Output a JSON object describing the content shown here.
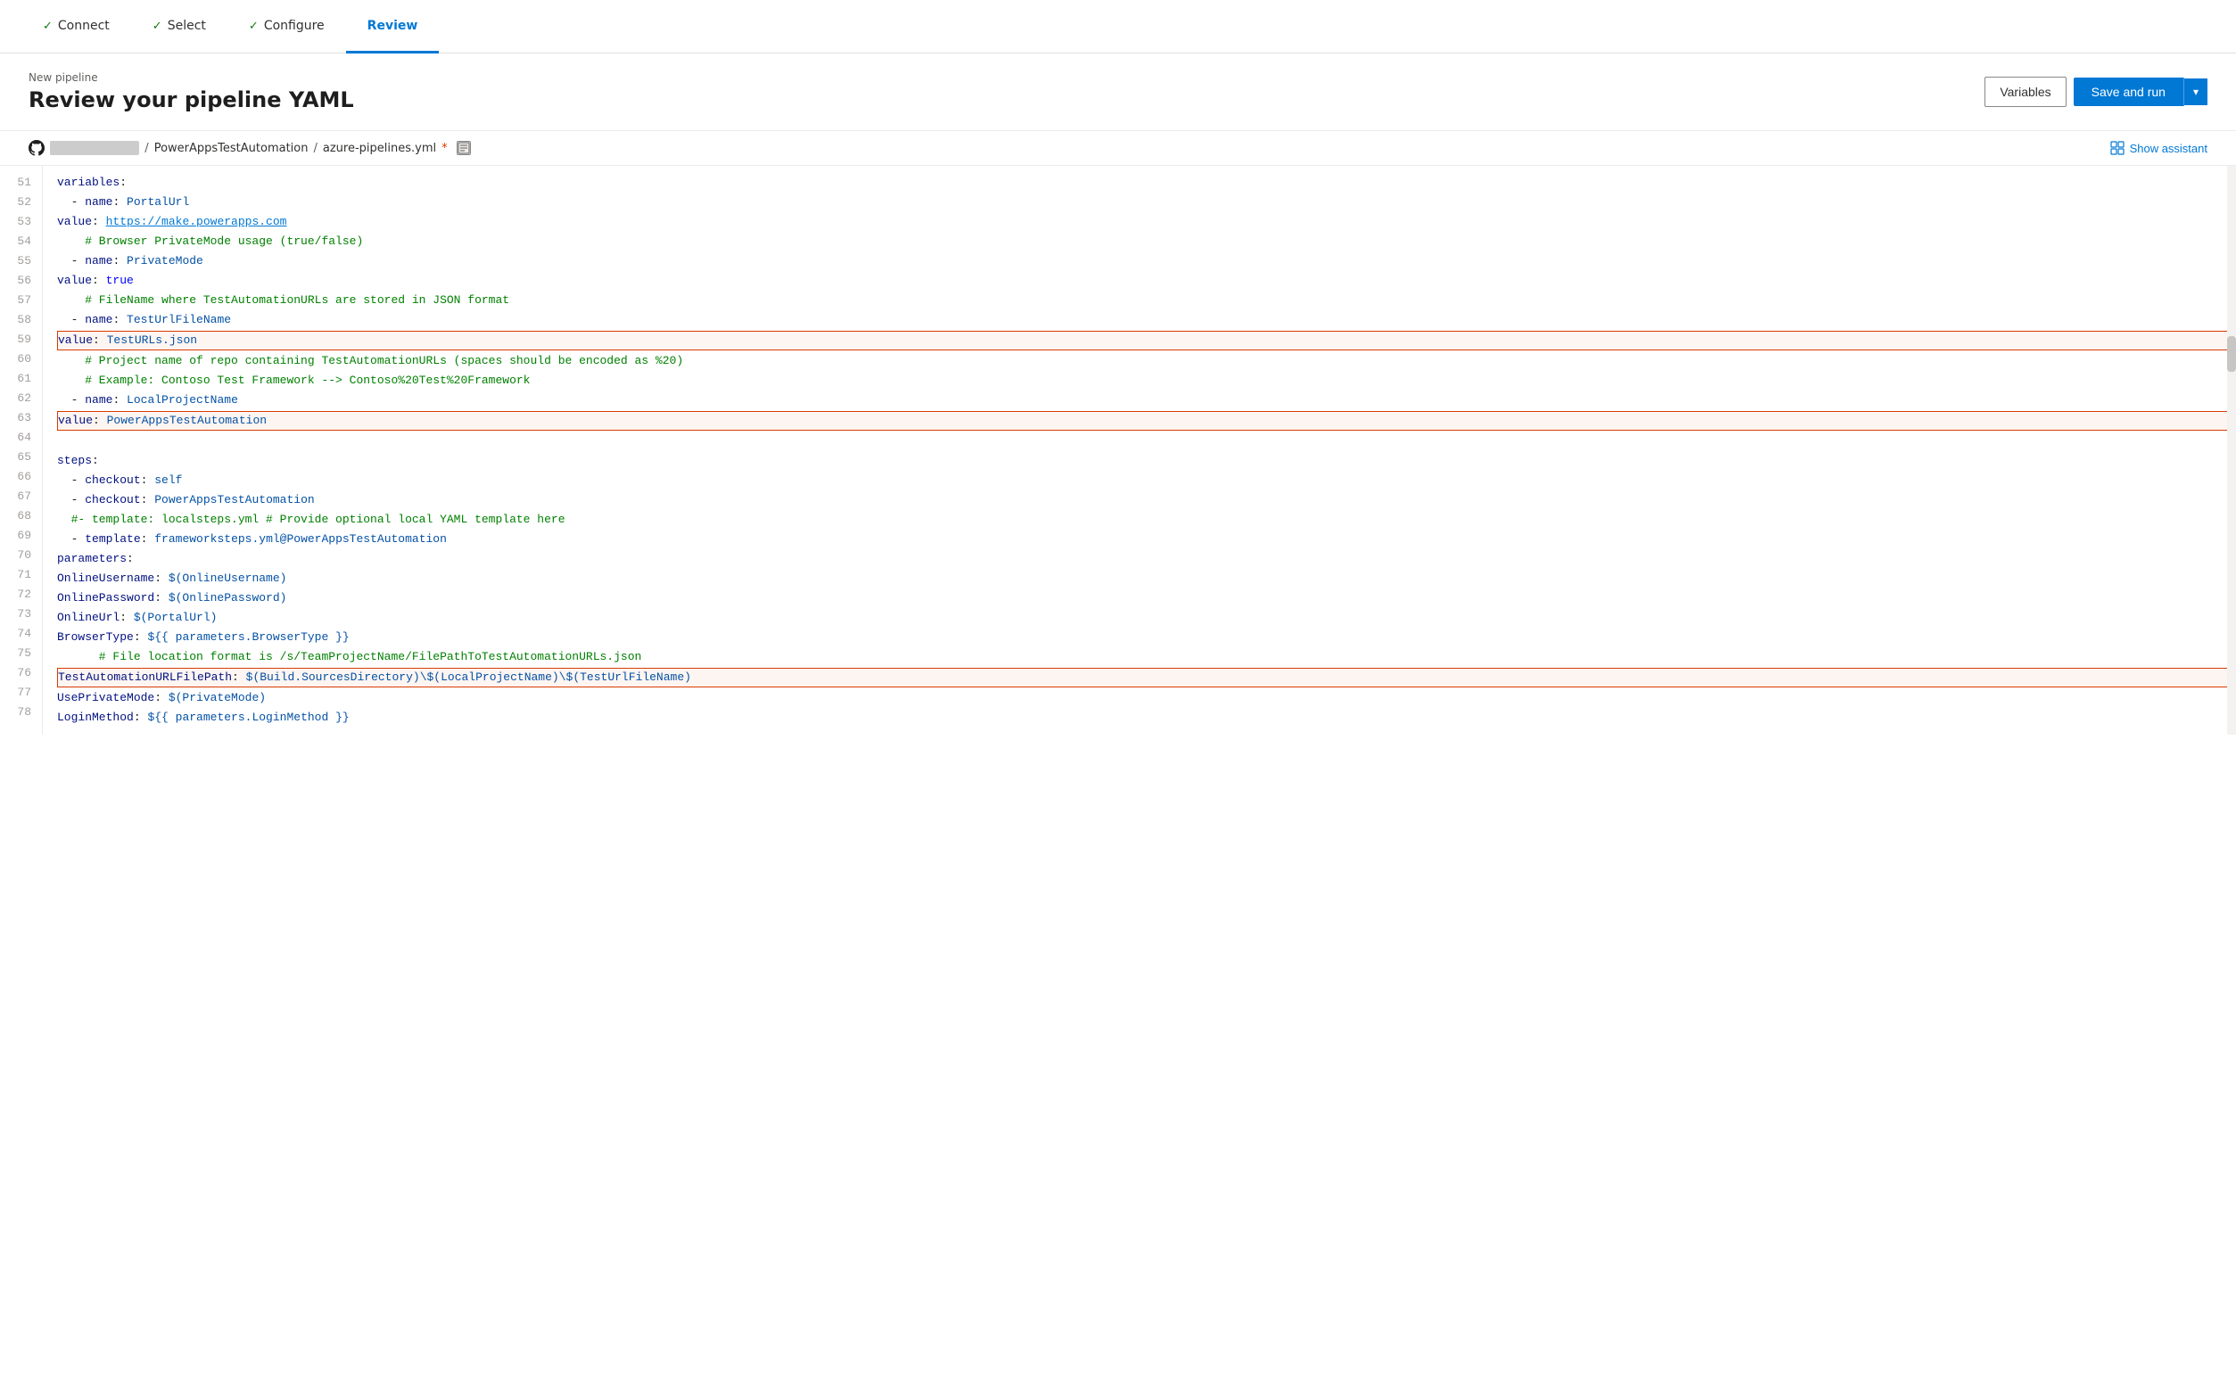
{
  "wizard": {
    "tabs": [
      {
        "id": "connect",
        "label": "Connect",
        "state": "completed"
      },
      {
        "id": "select",
        "label": "Select",
        "state": "completed"
      },
      {
        "id": "configure",
        "label": "Configure",
        "state": "completed"
      },
      {
        "id": "review",
        "label": "Review",
        "state": "active"
      }
    ]
  },
  "header": {
    "breadcrumb": "New pipeline",
    "title": "Review your pipeline YAML",
    "variables_label": "Variables",
    "save_run_label": "Save and run"
  },
  "file_bar": {
    "repo_placeholder": "██████████",
    "repo_name": "PowerAppsTestAutomation",
    "separator": "/",
    "filename": "azure-pipelines.yml",
    "modified_marker": "*",
    "show_assistant_label": "Show assistant"
  },
  "code": {
    "lines": [
      {
        "num": 51,
        "content": "variables:",
        "type": "key"
      },
      {
        "num": 52,
        "content": "  - name: PortalUrl",
        "type": "name"
      },
      {
        "num": 53,
        "content": "    value: https://make.powerapps.com",
        "type": "value-url"
      },
      {
        "num": 54,
        "content": "    # Browser PrivateMode usage (true/false)",
        "type": "comment"
      },
      {
        "num": 55,
        "content": "  - name: PrivateMode",
        "type": "name"
      },
      {
        "num": 56,
        "content": "    value: true",
        "type": "value-bool"
      },
      {
        "num": 57,
        "content": "    # FileName where TestAutomationURLs are stored in JSON format",
        "type": "comment"
      },
      {
        "num": 58,
        "content": "  - name: TestUrlFileName",
        "type": "name"
      },
      {
        "num": 59,
        "content": "    value: TestURLs.json",
        "type": "value-highlighted"
      },
      {
        "num": 60,
        "content": "    # Project name of repo containing TestAutomationURLs (spaces should be encoded as %20)",
        "type": "comment"
      },
      {
        "num": 61,
        "content": "    # Example: Contoso Test Framework --> Contoso%20Test%20Framework",
        "type": "comment"
      },
      {
        "num": 62,
        "content": "  - name: LocalProjectName",
        "type": "name"
      },
      {
        "num": 63,
        "content": "    value: PowerAppsTestAutomation",
        "type": "value-highlighted"
      },
      {
        "num": 64,
        "content": "",
        "type": "empty"
      },
      {
        "num": 65,
        "content": "  steps:",
        "type": "key"
      },
      {
        "num": 66,
        "content": "  - checkout: self",
        "type": "plain"
      },
      {
        "num": 67,
        "content": "  - checkout: PowerAppsTestAutomation",
        "type": "plain"
      },
      {
        "num": 68,
        "content": "  #- template: localsteps.yml # Provide optional local YAML template here",
        "type": "comment"
      },
      {
        "num": 69,
        "content": "  - template: frameworksteps.yml@PowerAppsTestAutomation",
        "type": "plain"
      },
      {
        "num": 70,
        "content": "    parameters:",
        "type": "key-indent"
      },
      {
        "num": 71,
        "content": "      OnlineUsername: $(OnlineUsername)",
        "type": "param"
      },
      {
        "num": 72,
        "content": "      OnlinePassword: $(OnlinePassword)",
        "type": "param"
      },
      {
        "num": 73,
        "content": "      OnlineUrl: $(PortalUrl)",
        "type": "param"
      },
      {
        "num": 74,
        "content": "      BrowserType: ${{ parameters.BrowserType }}",
        "type": "param"
      },
      {
        "num": 75,
        "content": "      # File location format is /s/TeamProjectName/FilePathToTestAutomationURLs.json",
        "type": "comment"
      },
      {
        "num": 76,
        "content": "      TestAutomationURLFilePath: $(Build.SourcesDirectory)\\$(LocalProjectName)\\$(TestUrlFileName)",
        "type": "param-highlighted"
      },
      {
        "num": 77,
        "content": "      UsePrivateMode: $(PrivateMode)",
        "type": "param"
      },
      {
        "num": 78,
        "content": "      LoginMethod: ${{ parameters.LoginMethod }}",
        "type": "param"
      }
    ]
  },
  "colors": {
    "accent": "#0078d4",
    "highlight_border": "#d83b01",
    "completed_check": "#107c10"
  }
}
